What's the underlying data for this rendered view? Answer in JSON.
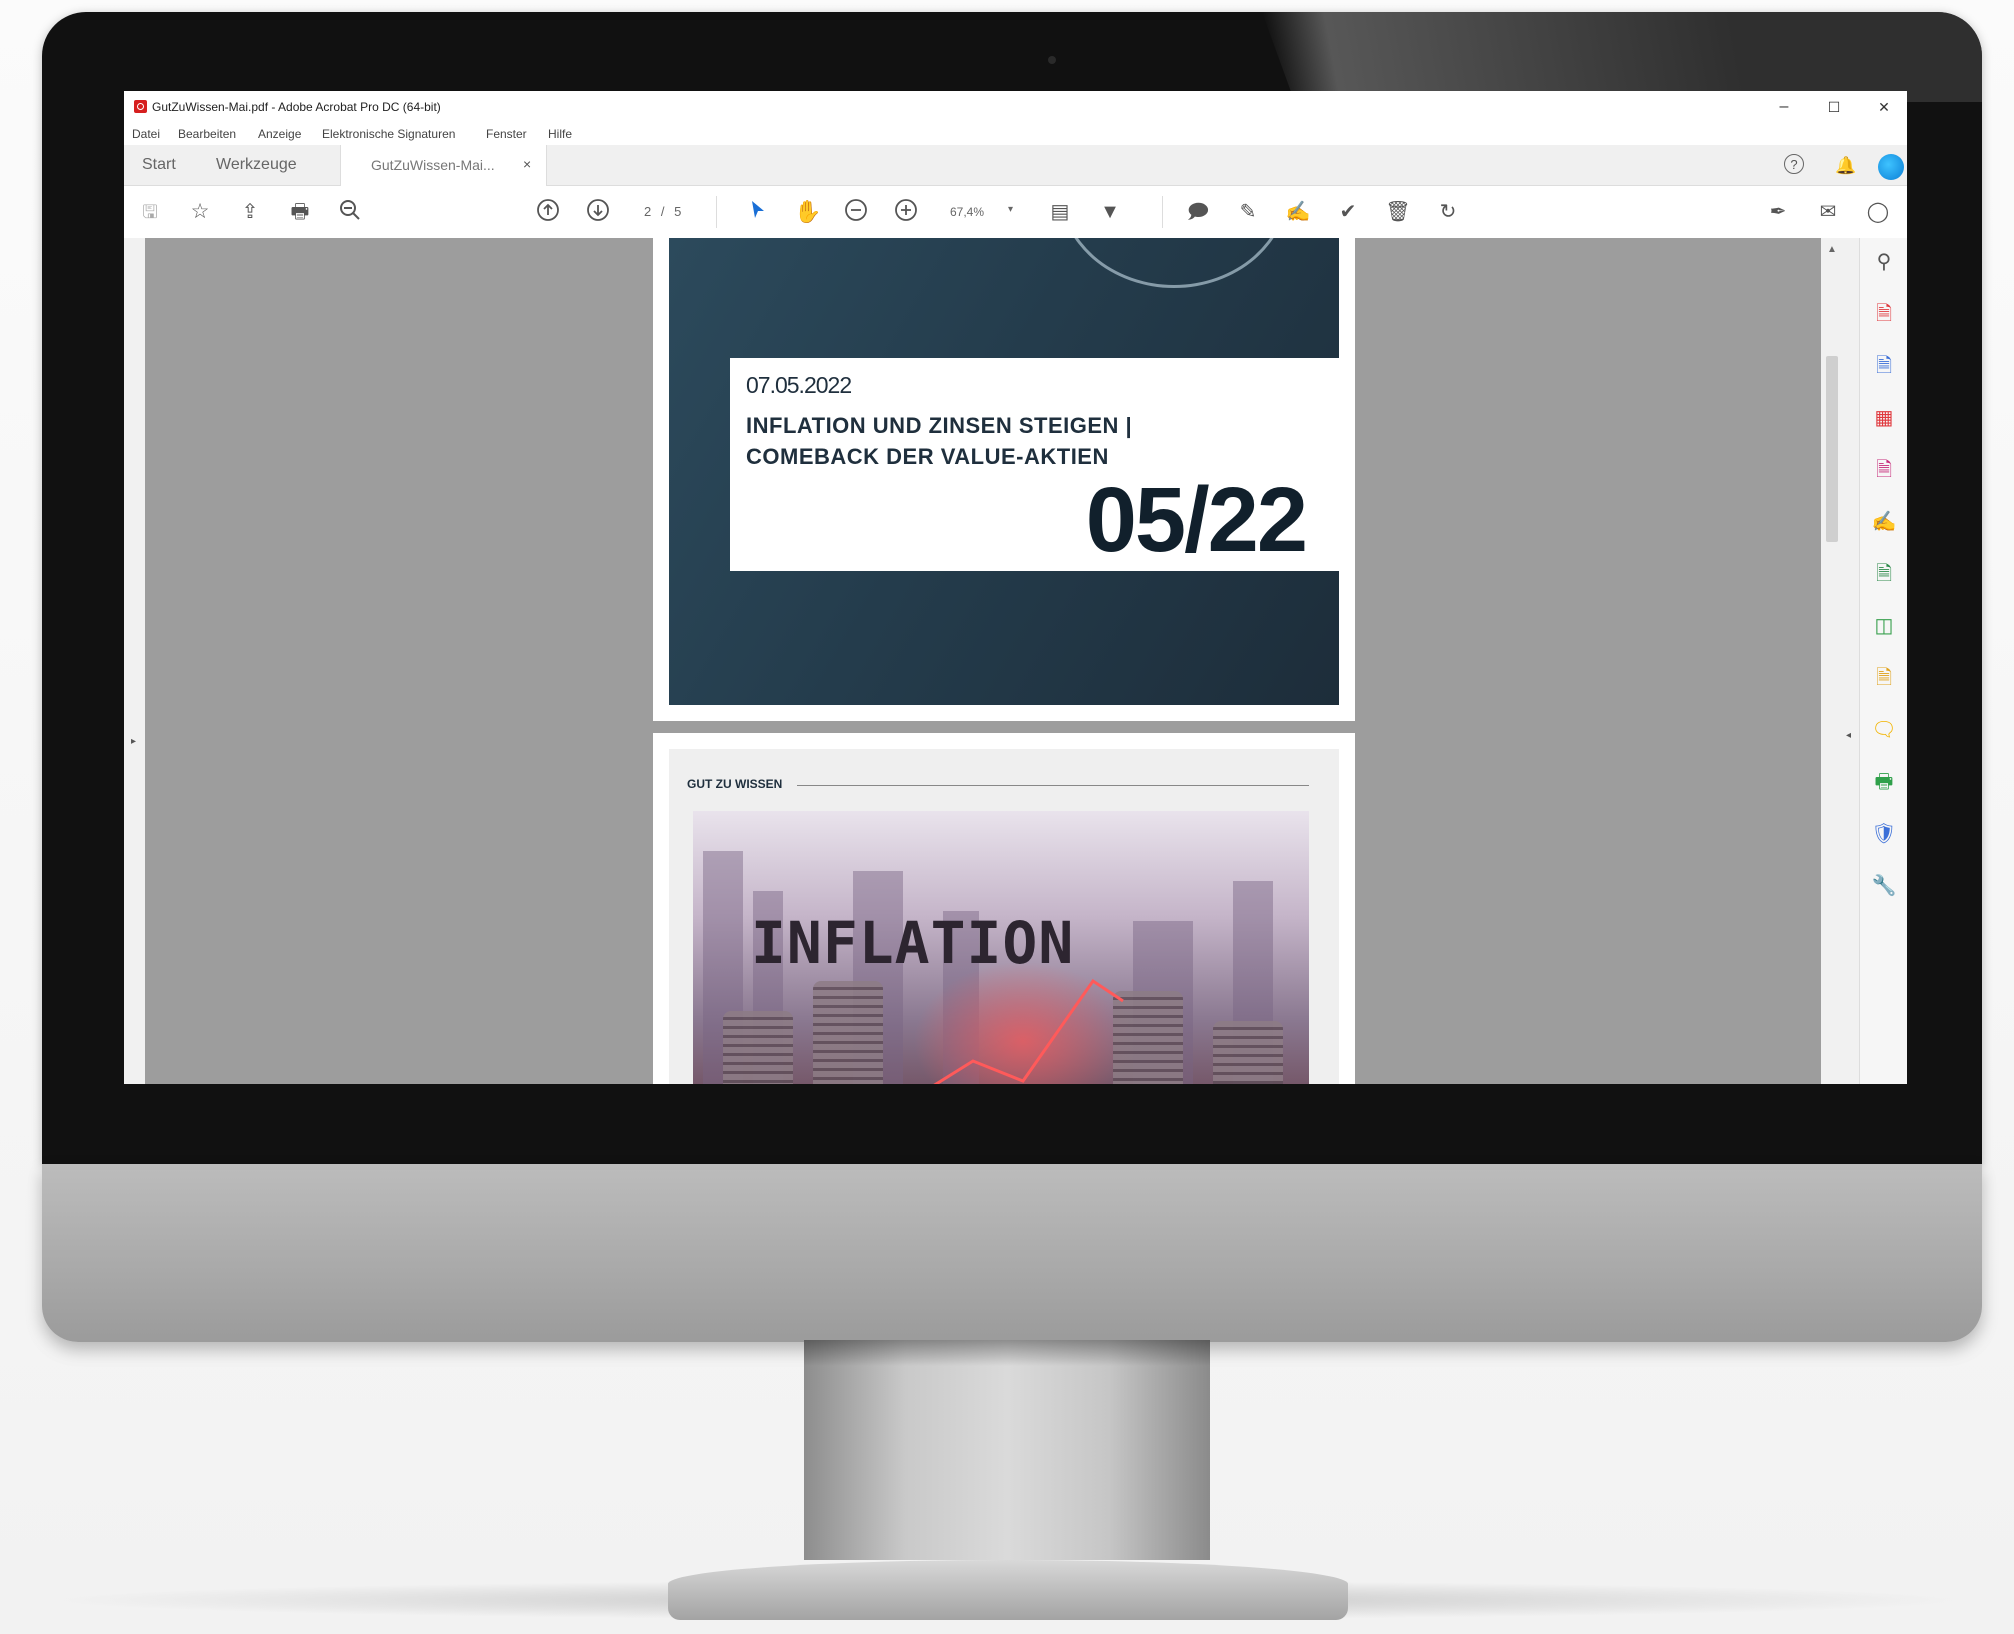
{
  "window": {
    "title": "GutZuWissen-Mai.pdf - Adobe Acrobat Pro DC (64-bit)",
    "minimize": "–",
    "maximize": "☐",
    "close": "✕"
  },
  "menu": [
    "Datei",
    "Bearbeiten",
    "Anzeige",
    "Elektronische Signaturen",
    "Fenster",
    "Hilfe"
  ],
  "tabs": {
    "start": "Start",
    "tools": "Werkzeuge",
    "document": "GutZuWissen-Mai...",
    "document_close": "×"
  },
  "topright_icons": [
    "help-icon",
    "bell-icon",
    "profile-icon"
  ],
  "toolbar": {
    "page_indicator": "2 / 5",
    "zoom": "67,4%",
    "icons": [
      "save-icon",
      "star-icon",
      "upload-icon",
      "print-icon",
      "zoom-out-search-icon",
      "page-up-icon",
      "page-down-icon",
      "select-pointer-icon",
      "hand-icon",
      "zoom-out-icon",
      "zoom-in-icon",
      "page-display-icon",
      "scroll-mode-icon",
      "comment-icon",
      "highlight-pen-icon",
      "sign-icon",
      "stamp-icon",
      "delete-icon",
      "rotate-icon",
      "fill-sign-icon",
      "email-icon",
      "share-icon"
    ]
  },
  "right_panel_icons": [
    "zoom-search-icon",
    "export-pdf-icon",
    "create-pdf-icon",
    "organize-pages-icon",
    "edit-pdf-icon",
    "fill-sign-icon",
    "send-for-review-icon",
    "compare-icon",
    "request-signature-icon",
    "comment-icon",
    "print-production-icon",
    "protect-icon",
    "more-tools-icon"
  ],
  "right_panel_colors": [
    "#555555",
    "#e0393e",
    "#3b6fd8",
    "#e0393e",
    "#c62b7a",
    "#8a4fd8",
    "#2d8a4a",
    "#3aa150",
    "#e0a21a",
    "#f2b400",
    "#2fa04a",
    "#3b6fd8",
    "#444444"
  ],
  "page1": {
    "date": "07.05.2022",
    "title_line1": "INFLATION UND ZINSEN STEIGEN |",
    "title_line2": "COMEBACK DER VALUE-AKTIEN",
    "issue": "05/22"
  },
  "page2": {
    "heading": "GUT ZU WISSEN",
    "image_text": "INFLATION"
  },
  "colors": {
    "accent": "#1f2f3d",
    "acrobat_red": "#d61f1f"
  }
}
